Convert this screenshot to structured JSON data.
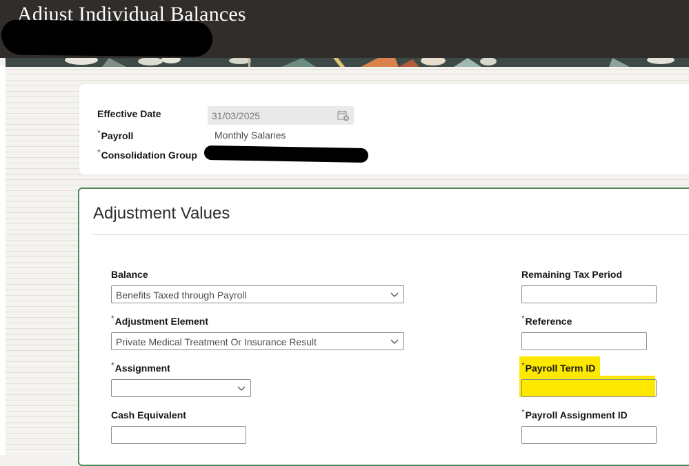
{
  "header": {
    "title": "Adjust Individual Balances"
  },
  "summary": {
    "effective_date_label": "Effective Date",
    "effective_date_value": "31/03/2025",
    "payroll_label": "Payroll",
    "payroll_value": "Monthly Salaries",
    "consolidation_group_label": "Consolidation Group"
  },
  "required_mark": "*",
  "section": {
    "title": "Adjustment Values",
    "balance_label": "Balance",
    "balance_value": "Benefits Taxed through Payroll",
    "adjustment_element_label": "Adjustment Element",
    "adjustment_element_value": "Private Medical Treatment Or Insurance Result",
    "assignment_label": "Assignment",
    "assignment_value": "",
    "cash_equivalent_label": "Cash Equivalent",
    "cash_equivalent_value": "",
    "remaining_tax_period_label": "Remaining Tax Period",
    "remaining_tax_period_value": "",
    "reference_label": "Reference",
    "reference_value": "",
    "payroll_term_id_label": "Payroll Term ID",
    "payroll_term_id_value": "",
    "payroll_assignment_id_label": "Payroll Assignment ID",
    "payroll_assignment_id_value": ""
  },
  "icons": {
    "calendar": "calendar-icon",
    "dropdown": "chevron-down-icon"
  },
  "colors": {
    "header_bg": "#312d2a",
    "panel_border": "#4e8a5b",
    "highlight": "#ffe800"
  }
}
